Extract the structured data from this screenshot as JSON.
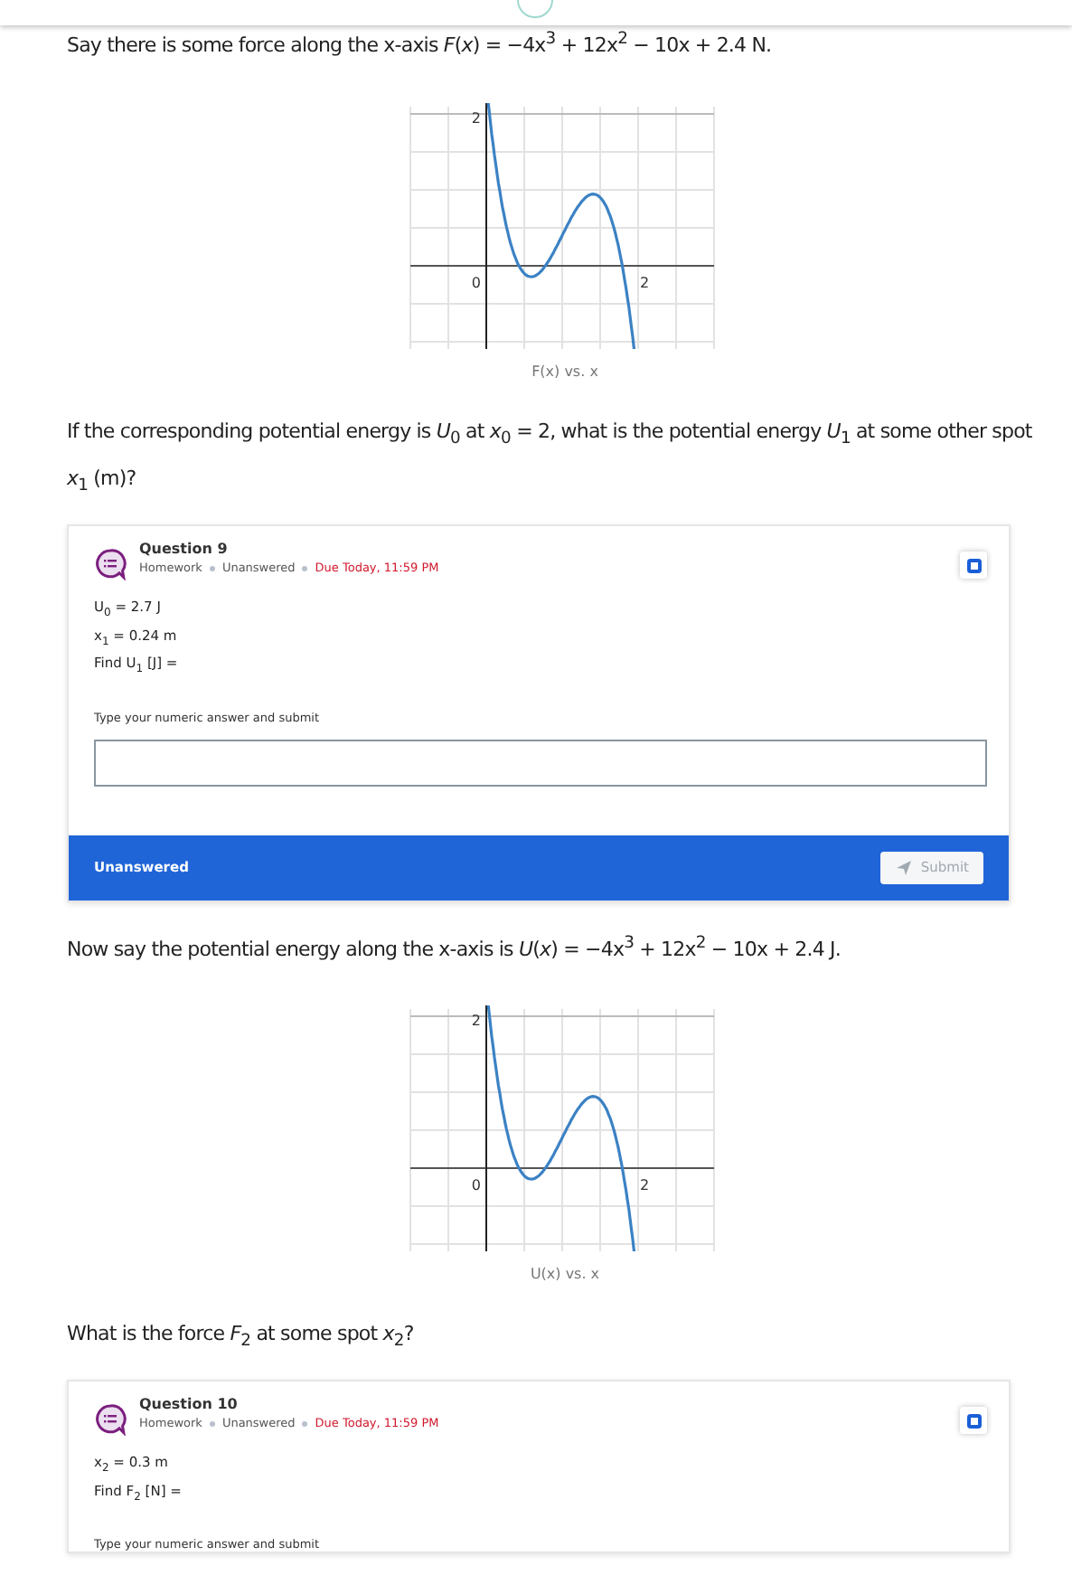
{
  "sections": [
    {
      "kind": "text",
      "text": "Say there is some force along the x-axis *F*(*x*) = −4x$^{3}$ + 12x$^{2}$ − 10x + 2.4 N."
    },
    {
      "kind": "graph",
      "y_tick": "2",
      "origin": "0",
      "x_tick": "2",
      "caption": "F(x) vs. x"
    },
    {
      "kind": "text",
      "text": "If the corresponding potential energy is *U*$_{0}$ at *x*$_{0}$ = 2, what is the potential energy *U*$_{1}$ at some other spot *x*$_{1}$ (m)?"
    },
    {
      "kind": "question",
      "title": "Question 9",
      "meta": [
        "Homework",
        "Unanswered"
      ],
      "due": "Due Today, 11:59 PM",
      "bookmarked": false,
      "lines": [
        "U$_{0}$ = 2.7 J",
        "x$_{1}$ = 0.24 m",
        "Find U$_{1}$ [J] ="
      ],
      "prompt": "Type your numeric answer and submit",
      "answer_field": true,
      "footer": {
        "status": "Unanswered",
        "button": "Submit",
        "disabled": true
      }
    },
    {
      "kind": "text",
      "text": "Now say the potential energy along the x-axis is *U*(*x*) = −4x$^{3}$ + 12x$^{2}$ − 10x + 2.4 J."
    },
    {
      "kind": "graph",
      "y_tick": "2",
      "origin": "0",
      "x_tick": "2",
      "caption": "U(x) vs. x"
    },
    {
      "kind": "text",
      "text": "What is the force *F*$_{2}$ at some spot *x*$_{2}$?"
    },
    {
      "kind": "question",
      "title": "Question 10",
      "meta": [
        "Homework",
        "Unanswered"
      ],
      "due": "Due Today, 11:59 PM",
      "bookmarked": false,
      "lines": [
        "x$_{2}$ = 0.3 m",
        "Find F$_{2}$ [N] ="
      ],
      "prompt": "Type your numeric answer and submit"
    }
  ]
}
